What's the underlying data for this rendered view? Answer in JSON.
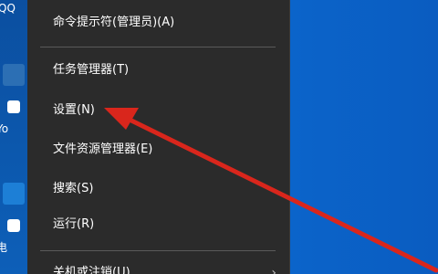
{
  "desktop": {
    "icon_labels": [
      "QQ",
      "Yo",
      "电"
    ]
  },
  "menu": {
    "items": [
      {
        "label": "命令提示符(管理员)(A)"
      },
      {
        "label": "任务管理器(T)"
      },
      {
        "label": "设置(N)"
      },
      {
        "label": "文件资源管理器(E)"
      },
      {
        "label": "搜索(S)"
      },
      {
        "label": "运行(R)"
      },
      {
        "label": "关机或注销(U)"
      }
    ]
  },
  "colors": {
    "menu_background": "#2b2b2b",
    "desktop_blue": "#0a64c8",
    "annotation_red": "#d9261c"
  },
  "icons": {
    "submenu": "chevron-right-icon"
  }
}
